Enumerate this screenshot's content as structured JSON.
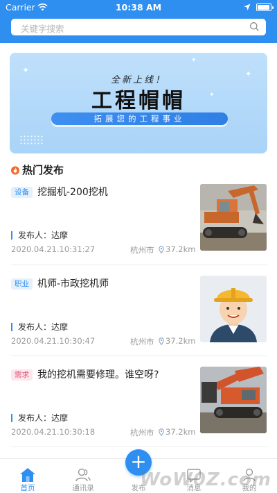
{
  "status": {
    "carrier": "Carrier",
    "time": "10:38 AM",
    "battery_level": 0.95
  },
  "search": {
    "placeholder": "关键字搜索"
  },
  "banner": {
    "subtitle": "全新上线！",
    "title": "工程帽帽",
    "slogan": "拓展您的工程事业"
  },
  "section": {
    "title": "热门发布"
  },
  "listings": [
    {
      "tag": "设备",
      "tag_color": "#2f8ff0",
      "tag_bg": "#e4f0fd",
      "title": "挖掘机-200挖机",
      "publisher": "发布人：达摩",
      "date": "2020.04.21.10:31:27",
      "city": "杭州市",
      "distance": "37.2km",
      "image": "excavator-photo"
    },
    {
      "tag": "职业",
      "tag_color": "#2f8ff0",
      "tag_bg": "#e4f0fd",
      "title": "机师-市政挖机师",
      "publisher": "发布人：达摩",
      "date": "2020.04.21.10:30:47",
      "city": "杭州市",
      "distance": "37.2km",
      "image": "worker-avatar"
    },
    {
      "tag": "需求",
      "tag_color": "#e2567a",
      "tag_bg": "#fde6ec",
      "title": "我的挖机需要修理。谁空呀?",
      "publisher": "发布人：达摩",
      "date": "2020.04.21.10:30:18",
      "city": "杭州市",
      "distance": "37.2km",
      "image": "excavator-photo"
    }
  ],
  "tabbar": {
    "home": "首页",
    "contacts": "通讯录",
    "publish": "发布",
    "messages": "消息",
    "mine": "我的"
  },
  "colors": {
    "primary": "#2f8ff0",
    "banner": "#b5d9f9"
  },
  "watermark": "WoW0Z.com"
}
